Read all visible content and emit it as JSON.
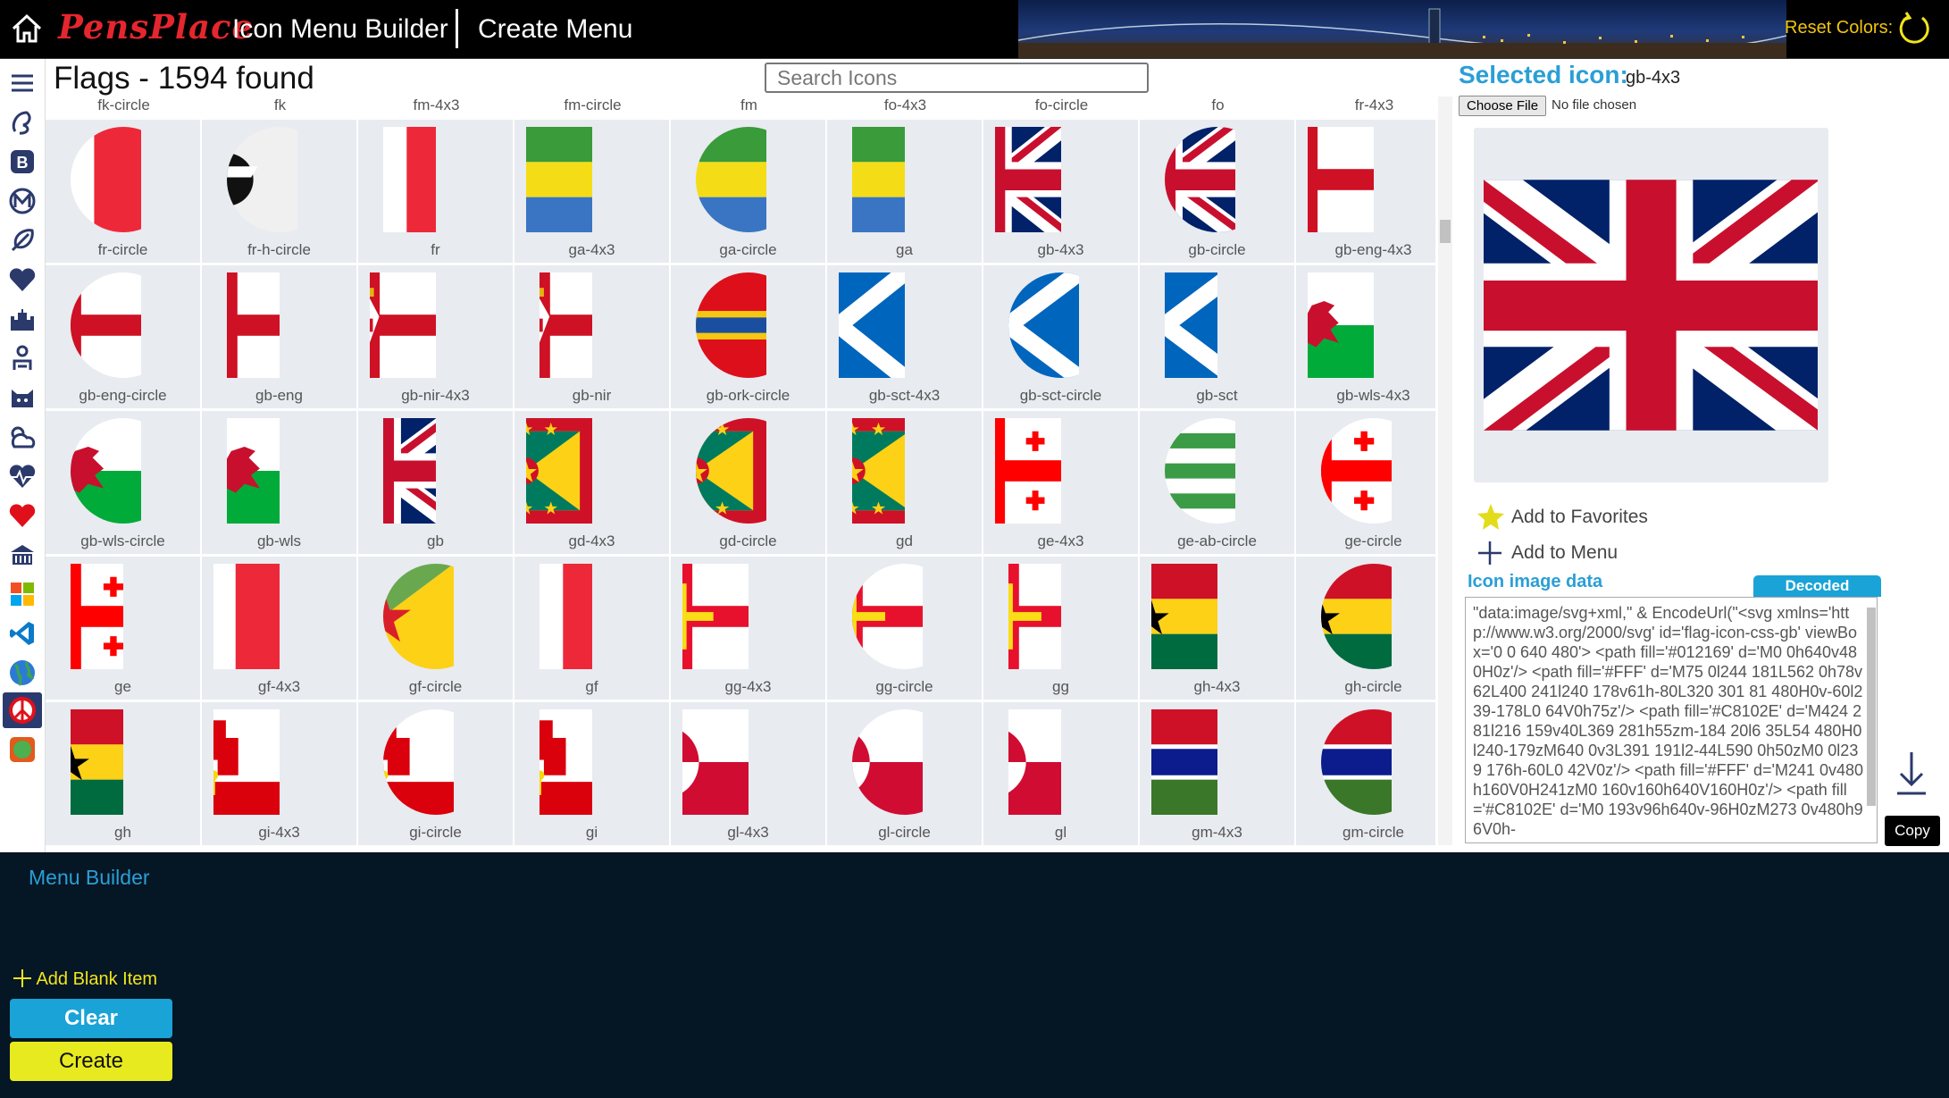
{
  "header": {
    "logo": "PensPlace",
    "app_title": "Icon Menu Builder",
    "page_title": "Create Menu",
    "reset_label": "Reset Colors:"
  },
  "sidebar": {
    "icons": [
      "menu-icon",
      "brand-icon",
      "bootstrap-icon",
      "material-icon",
      "feather-icon",
      "heart-icon",
      "castle-icon",
      "person-icon",
      "cat-icon",
      "weather-icon",
      "heartbeat-icon",
      "red-heart-icon",
      "building-icon",
      "windows-icon",
      "vscode-icon",
      "globe-icon",
      "peace-icon",
      "circle-icon"
    ]
  },
  "category_title": "Flags - 1594 found",
  "search": {
    "placeholder": "Search Icons"
  },
  "top_labels": [
    "fk-circle",
    "fk",
    "fm-4x3",
    "fm-circle",
    "fm",
    "fo-4x3",
    "fo-circle",
    "fo",
    "fr-4x3"
  ],
  "icons": [
    {
      "label": "fr-circle",
      "flag": "fr",
      "shape": "circle"
    },
    {
      "label": "fr-h-circle",
      "flag": "corsica",
      "shape": "circle"
    },
    {
      "label": "fr",
      "flag": "fr",
      "shape": "square"
    },
    {
      "label": "ga-4x3",
      "flag": "ga",
      "shape": "rect"
    },
    {
      "label": "ga-circle",
      "flag": "ga",
      "shape": "circle"
    },
    {
      "label": "ga",
      "flag": "ga",
      "shape": "square"
    },
    {
      "label": "gb-4x3",
      "flag": "gb",
      "shape": "rect"
    },
    {
      "label": "gb-circle",
      "flag": "gb",
      "shape": "circle"
    },
    {
      "label": "gb-eng-4x3",
      "flag": "eng",
      "shape": "rect"
    },
    {
      "label": "gb-eng-circle",
      "flag": "eng",
      "shape": "circle"
    },
    {
      "label": "gb-eng",
      "flag": "eng",
      "shape": "square"
    },
    {
      "label": "gb-nir-4x3",
      "flag": "nir",
      "shape": "rect"
    },
    {
      "label": "gb-nir",
      "flag": "nir",
      "shape": "square"
    },
    {
      "label": "gb-ork-circle",
      "flag": "ork",
      "shape": "circle"
    },
    {
      "label": "gb-sct-4x3",
      "flag": "sct",
      "shape": "rect"
    },
    {
      "label": "gb-sct-circle",
      "flag": "sct",
      "shape": "circle"
    },
    {
      "label": "gb-sct",
      "flag": "sct",
      "shape": "square"
    },
    {
      "label": "gb-wls-4x3",
      "flag": "wls",
      "shape": "rect"
    },
    {
      "label": "gb-wls-circle",
      "flag": "wls",
      "shape": "circle"
    },
    {
      "label": "gb-wls",
      "flag": "wls",
      "shape": "square"
    },
    {
      "label": "gb",
      "flag": "gb",
      "shape": "square"
    },
    {
      "label": "gd-4x3",
      "flag": "gd",
      "shape": "rect"
    },
    {
      "label": "gd-circle",
      "flag": "gd",
      "shape": "circle"
    },
    {
      "label": "gd",
      "flag": "gd",
      "shape": "square"
    },
    {
      "label": "ge-4x3",
      "flag": "ge",
      "shape": "rect"
    },
    {
      "label": "ge-ab-circle",
      "flag": "ab",
      "shape": "circle"
    },
    {
      "label": "ge-circle",
      "flag": "ge",
      "shape": "circle"
    },
    {
      "label": "ge",
      "flag": "ge",
      "shape": "square"
    },
    {
      "label": "gf-4x3",
      "flag": "fr",
      "shape": "rect"
    },
    {
      "label": "gf-circle",
      "flag": "gf",
      "shape": "circle"
    },
    {
      "label": "gf",
      "flag": "fr",
      "shape": "square"
    },
    {
      "label": "gg-4x3",
      "flag": "gg",
      "shape": "rect"
    },
    {
      "label": "gg-circle",
      "flag": "gg",
      "shape": "circle"
    },
    {
      "label": "gg",
      "flag": "gg",
      "shape": "square"
    },
    {
      "label": "gh-4x3",
      "flag": "gh",
      "shape": "rect"
    },
    {
      "label": "gh-circle",
      "flag": "gh",
      "shape": "circle"
    },
    {
      "label": "gh",
      "flag": "gh",
      "shape": "square"
    },
    {
      "label": "gi-4x3",
      "flag": "gi",
      "shape": "rect"
    },
    {
      "label": "gi-circle",
      "flag": "gi",
      "shape": "circle"
    },
    {
      "label": "gi",
      "flag": "gi",
      "shape": "square"
    },
    {
      "label": "gl-4x3",
      "flag": "gl",
      "shape": "rect"
    },
    {
      "label": "gl-circle",
      "flag": "gl",
      "shape": "circle"
    },
    {
      "label": "gl",
      "flag": "gl",
      "shape": "square"
    },
    {
      "label": "gm-4x3",
      "flag": "gm",
      "shape": "rect"
    },
    {
      "label": "gm-circle",
      "flag": "gm",
      "shape": "circle"
    }
  ],
  "selected": {
    "title": "Selected icon:",
    "name": "gb-4x3",
    "choose_file": "Choose File",
    "no_file": "No file chosen",
    "add_favorites": "Add to Favorites",
    "add_menu": "Add to Menu",
    "image_data_label": "Icon image data",
    "decoded_tab": "Decoded",
    "code": "\"data:image/svg+xml,\" & EncodeUrl(\"<svg xmlns='http://www.w3.org/2000/svg' id='flag-icon-css-gb' viewBox='0 0 640 480'>  <path fill='#012169' d='M0 0h640v480H0z'/>   <path fill='#FFF' d='M75 0l244 181L562 0h78v62L400 241l240 178v61h-80L320 301 81 480H0v-60l239-178L0 64V0h75z'/>   <path fill='#C8102E' d='M424 281l216 159v40L369 281h55zm-184 20l6 35L54 480H0l240-179zM640 0v3L391 191l2-44L590 0h50zM0 0l239 176h-60L0 42V0z'/>   <path fill='#FFF' d='M241 0v480h160V0H241zM0 160v160h640V160H0z'/>   <path fill='#C8102E' d='M0 193v96h640v-96H0zM273 0v480h96V0h-",
    "copy": "Copy"
  },
  "builder": {
    "title": "Menu Builder",
    "add_blank": "Add Blank Item",
    "clear": "Clear",
    "create": "Create"
  },
  "colors": {
    "accent": "#2a9fd6",
    "clear_button": "#1aa3d6",
    "create_button": "#e7ea1f",
    "builder_bg": "#051624",
    "cell_bg": "#e8ebf0"
  }
}
